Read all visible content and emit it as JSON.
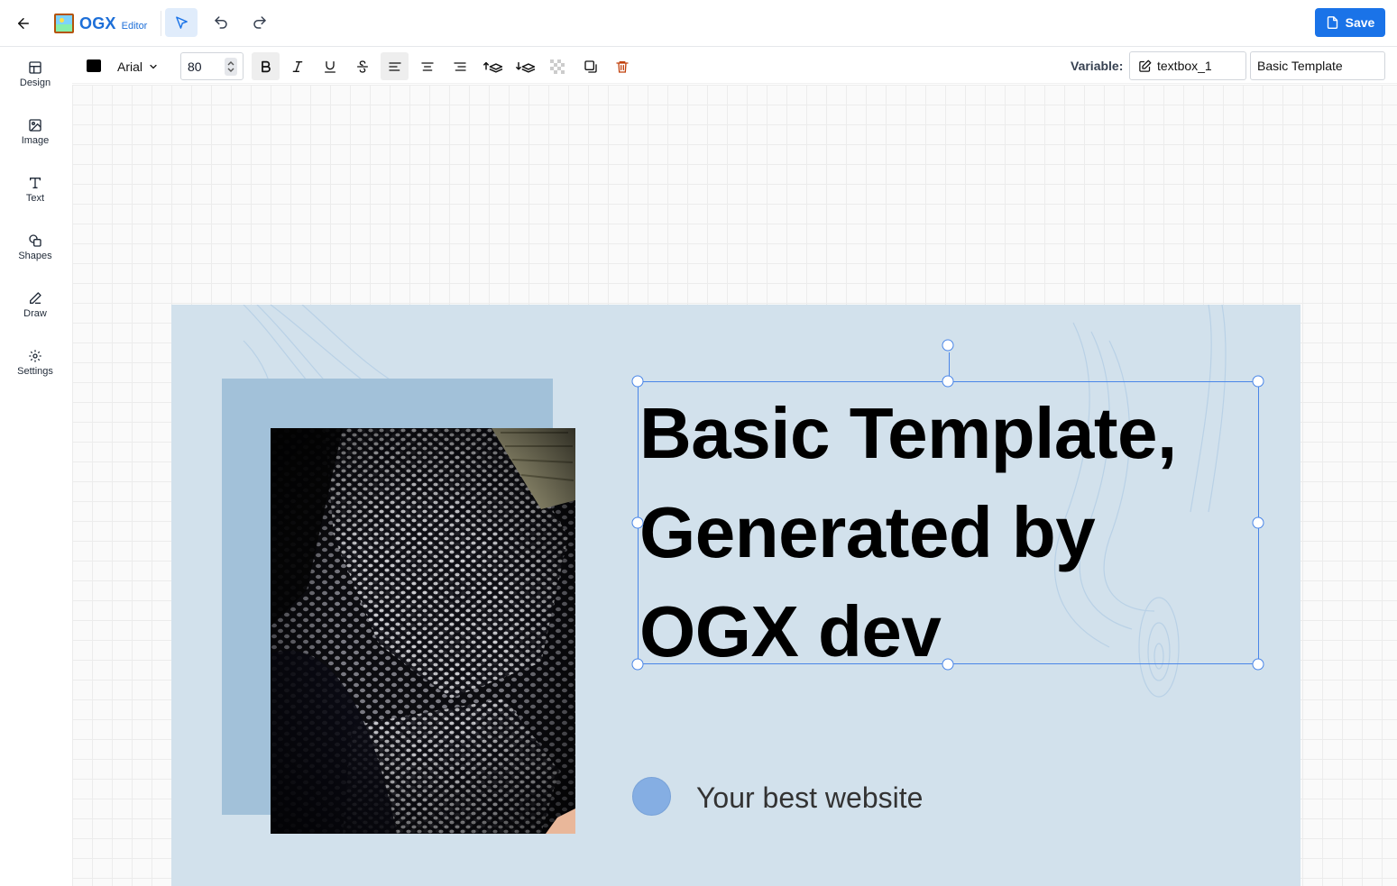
{
  "header": {
    "logo_text": "OGX",
    "logo_sub": "Editor",
    "save_label": "Save"
  },
  "sidebar": {
    "items": [
      {
        "label": "Design",
        "icon": "layout-icon"
      },
      {
        "label": "Image",
        "icon": "image-icon"
      },
      {
        "label": "Text",
        "icon": "text-icon"
      },
      {
        "label": "Shapes",
        "icon": "shapes-icon"
      },
      {
        "label": "Draw",
        "icon": "pencil-icon"
      },
      {
        "label": "Settings",
        "icon": "gear-icon"
      }
    ]
  },
  "toolbar": {
    "text_color": "#000000",
    "font_family": "Arial",
    "font_size": "80",
    "variable_label": "Variable:",
    "variable_value": "textbox_1",
    "template_name": "Basic Template"
  },
  "canvas": {
    "headline": "Basic Template, Generated by OGX dev",
    "tagline": "Your best website",
    "background_color": "#d2e1ec",
    "accent_color": "#85aee3",
    "selection_color": "#4a86e8"
  },
  "colors": {
    "brand": "#1a73e8"
  }
}
